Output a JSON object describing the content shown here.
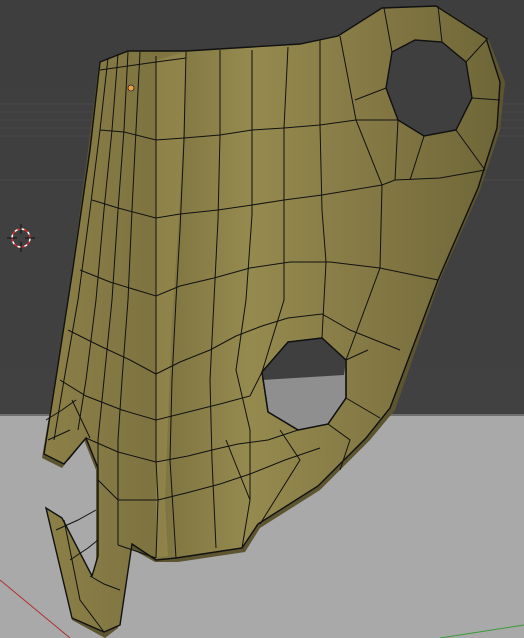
{
  "viewport": {
    "colors": {
      "background_upper": "#3f3f3f",
      "background_lower": "#a9a9a9",
      "horizon_line": "#6f6f6f",
      "mesh_fill": "#857a45",
      "mesh_highlight": "#a59856",
      "mesh_shadow": "#5d5530",
      "wire": "#111111",
      "cursor_red": "#d12a2a",
      "cursor_white": "#ffffff",
      "origin_dot": "#f0a040",
      "axis_red": "#b03030",
      "axis_green": "#3a9a3a"
    },
    "icons": {
      "cursor": "3d-cursor-icon",
      "origin": "object-origin-icon"
    }
  }
}
